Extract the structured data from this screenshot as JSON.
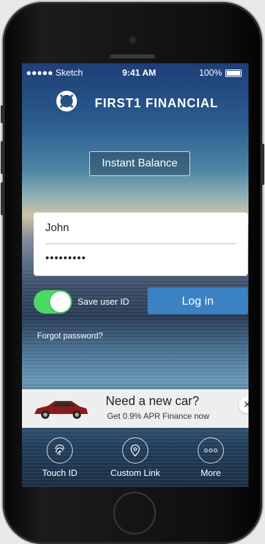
{
  "status_bar": {
    "carrier": "●●●●● Sketch",
    "time": "9:41 AM",
    "battery": "100%"
  },
  "brand": {
    "name": "FIRST1 FINANCIAL"
  },
  "instant_balance_label": "Instant Balance",
  "login_form": {
    "username_value": "John",
    "password_value": "•••••••••"
  },
  "save_user_id": {
    "label": "Save user ID",
    "enabled": true
  },
  "login_button_label": "Log in",
  "forgot_password_label": "Forgot password?",
  "ad": {
    "title": "Need a new car?",
    "subtitle": "Get 0.9% APR Finance now",
    "close_glyph": "×"
  },
  "bottom_nav": [
    {
      "label": "Touch ID",
      "icon": "fingerprint-icon"
    },
    {
      "label": "Custom Link",
      "icon": "location-pin-icon"
    },
    {
      "label": "More",
      "icon": "more-dots-icon"
    }
  ],
  "colors": {
    "toggle_on": "#4cd964",
    "login_button": "#3b82c4"
  }
}
